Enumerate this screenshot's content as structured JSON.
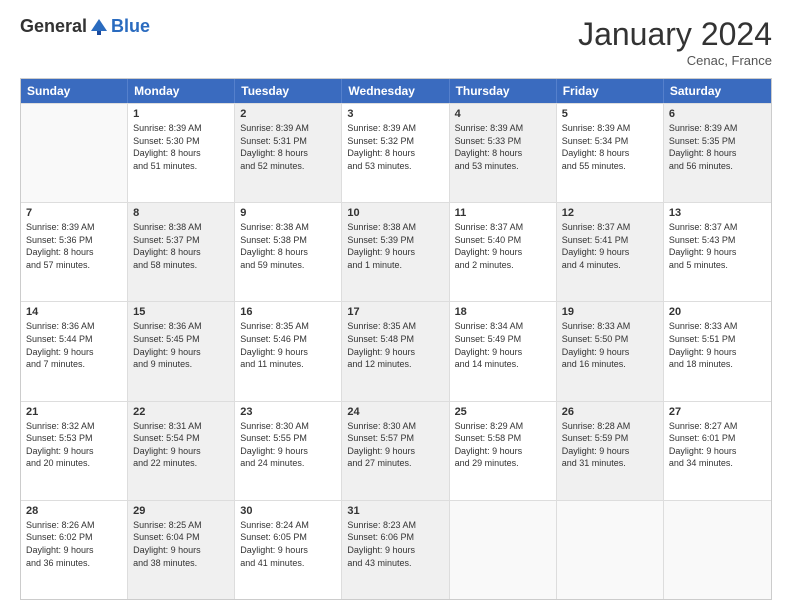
{
  "header": {
    "logo_general": "General",
    "logo_blue": "Blue",
    "month_title": "January 2024",
    "location": "Cenac, France"
  },
  "days_of_week": [
    "Sunday",
    "Monday",
    "Tuesday",
    "Wednesday",
    "Thursday",
    "Friday",
    "Saturday"
  ],
  "weeks": [
    [
      {
        "day": "",
        "empty": true,
        "shaded": false,
        "lines": []
      },
      {
        "day": "1",
        "empty": false,
        "shaded": false,
        "lines": [
          "Sunrise: 8:39 AM",
          "Sunset: 5:30 PM",
          "Daylight: 8 hours",
          "and 51 minutes."
        ]
      },
      {
        "day": "2",
        "empty": false,
        "shaded": true,
        "lines": [
          "Sunrise: 8:39 AM",
          "Sunset: 5:31 PM",
          "Daylight: 8 hours",
          "and 52 minutes."
        ]
      },
      {
        "day": "3",
        "empty": false,
        "shaded": false,
        "lines": [
          "Sunrise: 8:39 AM",
          "Sunset: 5:32 PM",
          "Daylight: 8 hours",
          "and 53 minutes."
        ]
      },
      {
        "day": "4",
        "empty": false,
        "shaded": true,
        "lines": [
          "Sunrise: 8:39 AM",
          "Sunset: 5:33 PM",
          "Daylight: 8 hours",
          "and 53 minutes."
        ]
      },
      {
        "day": "5",
        "empty": false,
        "shaded": false,
        "lines": [
          "Sunrise: 8:39 AM",
          "Sunset: 5:34 PM",
          "Daylight: 8 hours",
          "and 55 minutes."
        ]
      },
      {
        "day": "6",
        "empty": false,
        "shaded": true,
        "lines": [
          "Sunrise: 8:39 AM",
          "Sunset: 5:35 PM",
          "Daylight: 8 hours",
          "and 56 minutes."
        ]
      }
    ],
    [
      {
        "day": "7",
        "empty": false,
        "shaded": false,
        "lines": [
          "Sunrise: 8:39 AM",
          "Sunset: 5:36 PM",
          "Daylight: 8 hours",
          "and 57 minutes."
        ]
      },
      {
        "day": "8",
        "empty": false,
        "shaded": true,
        "lines": [
          "Sunrise: 8:38 AM",
          "Sunset: 5:37 PM",
          "Daylight: 8 hours",
          "and 58 minutes."
        ]
      },
      {
        "day": "9",
        "empty": false,
        "shaded": false,
        "lines": [
          "Sunrise: 8:38 AM",
          "Sunset: 5:38 PM",
          "Daylight: 8 hours",
          "and 59 minutes."
        ]
      },
      {
        "day": "10",
        "empty": false,
        "shaded": true,
        "lines": [
          "Sunrise: 8:38 AM",
          "Sunset: 5:39 PM",
          "Daylight: 9 hours",
          "and 1 minute."
        ]
      },
      {
        "day": "11",
        "empty": false,
        "shaded": false,
        "lines": [
          "Sunrise: 8:37 AM",
          "Sunset: 5:40 PM",
          "Daylight: 9 hours",
          "and 2 minutes."
        ]
      },
      {
        "day": "12",
        "empty": false,
        "shaded": true,
        "lines": [
          "Sunrise: 8:37 AM",
          "Sunset: 5:41 PM",
          "Daylight: 9 hours",
          "and 4 minutes."
        ]
      },
      {
        "day": "13",
        "empty": false,
        "shaded": false,
        "lines": [
          "Sunrise: 8:37 AM",
          "Sunset: 5:43 PM",
          "Daylight: 9 hours",
          "and 5 minutes."
        ]
      }
    ],
    [
      {
        "day": "14",
        "empty": false,
        "shaded": false,
        "lines": [
          "Sunrise: 8:36 AM",
          "Sunset: 5:44 PM",
          "Daylight: 9 hours",
          "and 7 minutes."
        ]
      },
      {
        "day": "15",
        "empty": false,
        "shaded": true,
        "lines": [
          "Sunrise: 8:36 AM",
          "Sunset: 5:45 PM",
          "Daylight: 9 hours",
          "and 9 minutes."
        ]
      },
      {
        "day": "16",
        "empty": false,
        "shaded": false,
        "lines": [
          "Sunrise: 8:35 AM",
          "Sunset: 5:46 PM",
          "Daylight: 9 hours",
          "and 11 minutes."
        ]
      },
      {
        "day": "17",
        "empty": false,
        "shaded": true,
        "lines": [
          "Sunrise: 8:35 AM",
          "Sunset: 5:48 PM",
          "Daylight: 9 hours",
          "and 12 minutes."
        ]
      },
      {
        "day": "18",
        "empty": false,
        "shaded": false,
        "lines": [
          "Sunrise: 8:34 AM",
          "Sunset: 5:49 PM",
          "Daylight: 9 hours",
          "and 14 minutes."
        ]
      },
      {
        "day": "19",
        "empty": false,
        "shaded": true,
        "lines": [
          "Sunrise: 8:33 AM",
          "Sunset: 5:50 PM",
          "Daylight: 9 hours",
          "and 16 minutes."
        ]
      },
      {
        "day": "20",
        "empty": false,
        "shaded": false,
        "lines": [
          "Sunrise: 8:33 AM",
          "Sunset: 5:51 PM",
          "Daylight: 9 hours",
          "and 18 minutes."
        ]
      }
    ],
    [
      {
        "day": "21",
        "empty": false,
        "shaded": false,
        "lines": [
          "Sunrise: 8:32 AM",
          "Sunset: 5:53 PM",
          "Daylight: 9 hours",
          "and 20 minutes."
        ]
      },
      {
        "day": "22",
        "empty": false,
        "shaded": true,
        "lines": [
          "Sunrise: 8:31 AM",
          "Sunset: 5:54 PM",
          "Daylight: 9 hours",
          "and 22 minutes."
        ]
      },
      {
        "day": "23",
        "empty": false,
        "shaded": false,
        "lines": [
          "Sunrise: 8:30 AM",
          "Sunset: 5:55 PM",
          "Daylight: 9 hours",
          "and 24 minutes."
        ]
      },
      {
        "day": "24",
        "empty": false,
        "shaded": true,
        "lines": [
          "Sunrise: 8:30 AM",
          "Sunset: 5:57 PM",
          "Daylight: 9 hours",
          "and 27 minutes."
        ]
      },
      {
        "day": "25",
        "empty": false,
        "shaded": false,
        "lines": [
          "Sunrise: 8:29 AM",
          "Sunset: 5:58 PM",
          "Daylight: 9 hours",
          "and 29 minutes."
        ]
      },
      {
        "day": "26",
        "empty": false,
        "shaded": true,
        "lines": [
          "Sunrise: 8:28 AM",
          "Sunset: 5:59 PM",
          "Daylight: 9 hours",
          "and 31 minutes."
        ]
      },
      {
        "day": "27",
        "empty": false,
        "shaded": false,
        "lines": [
          "Sunrise: 8:27 AM",
          "Sunset: 6:01 PM",
          "Daylight: 9 hours",
          "and 34 minutes."
        ]
      }
    ],
    [
      {
        "day": "28",
        "empty": false,
        "shaded": false,
        "lines": [
          "Sunrise: 8:26 AM",
          "Sunset: 6:02 PM",
          "Daylight: 9 hours",
          "and 36 minutes."
        ]
      },
      {
        "day": "29",
        "empty": false,
        "shaded": true,
        "lines": [
          "Sunrise: 8:25 AM",
          "Sunset: 6:04 PM",
          "Daylight: 9 hours",
          "and 38 minutes."
        ]
      },
      {
        "day": "30",
        "empty": false,
        "shaded": false,
        "lines": [
          "Sunrise: 8:24 AM",
          "Sunset: 6:05 PM",
          "Daylight: 9 hours",
          "and 41 minutes."
        ]
      },
      {
        "day": "31",
        "empty": false,
        "shaded": true,
        "lines": [
          "Sunrise: 8:23 AM",
          "Sunset: 6:06 PM",
          "Daylight: 9 hours",
          "and 43 minutes."
        ]
      },
      {
        "day": "",
        "empty": true,
        "shaded": false,
        "lines": []
      },
      {
        "day": "",
        "empty": true,
        "shaded": false,
        "lines": []
      },
      {
        "day": "",
        "empty": true,
        "shaded": false,
        "lines": []
      }
    ]
  ]
}
